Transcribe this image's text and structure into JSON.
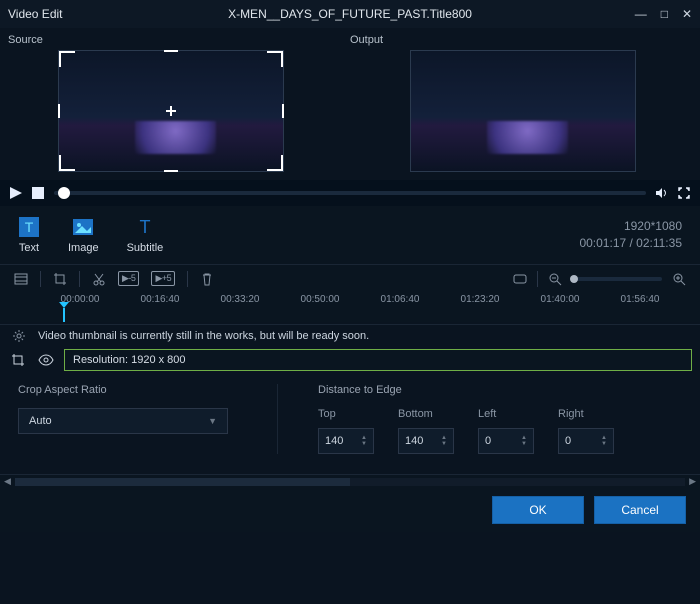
{
  "titlebar": {
    "app": "Video Edit",
    "file": "X-MEN__DAYS_OF_FUTURE_PAST.Title800"
  },
  "preview": {
    "source_label": "Source",
    "output_label": "Output"
  },
  "tools": {
    "text": "Text",
    "image": "Image",
    "subtitle": "Subtitle"
  },
  "meta": {
    "resolution": "1920*1080",
    "time": "00:01:17 / 02:11:35"
  },
  "roll": {
    "back": "▶-5",
    "fwd": "▶+5"
  },
  "ruler": [
    "00:00:00",
    "00:16:40",
    "00:33:20",
    "00:50:00",
    "01:06:40",
    "01:23:20",
    "01:40:00",
    "01:56:40"
  ],
  "notice": "Video thumbnail is currently still in the works, but will be ready soon.",
  "resolution_row": "Resolution: 1920 x 800",
  "crop": {
    "aspect_title": "Crop Aspect Ratio",
    "aspect_value": "Auto",
    "distance_title": "Distance to Edge",
    "labels": {
      "top": "Top",
      "bottom": "Bottom",
      "left": "Left",
      "right": "Right"
    },
    "values": {
      "top": "140",
      "bottom": "140",
      "left": "0",
      "right": "0"
    }
  },
  "footer": {
    "ok": "OK",
    "cancel": "Cancel"
  }
}
